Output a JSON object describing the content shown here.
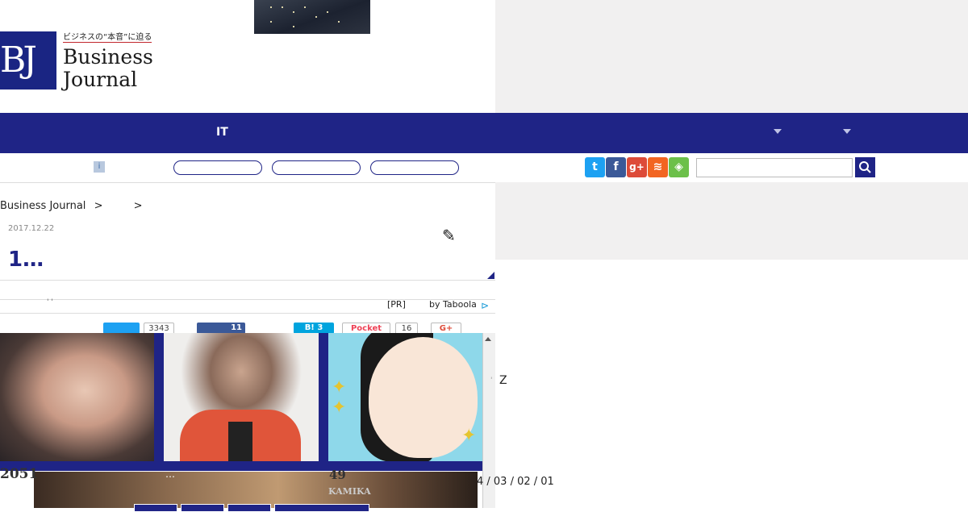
{
  "header": {
    "logo": {
      "mark": "BJ",
      "tagline": "ビジネスの“本音”に迫る",
      "word1": "Business",
      "word2": "Journal"
    }
  },
  "nav": {
    "items": [
      {
        "label": "IT"
      }
    ]
  },
  "social_icons": [
    {
      "name": "twitter",
      "color": "#1da1f2",
      "glyph": "t"
    },
    {
      "name": "facebook",
      "color": "#3b5998",
      "glyph": "f"
    },
    {
      "name": "google-plus",
      "color": "#dd4b39",
      "glyph": "g+"
    },
    {
      "name": "rss",
      "color": "#f26522",
      "glyph": "≋"
    },
    {
      "name": "feedly",
      "color": "#6cc04a",
      "glyph": "◈"
    }
  ],
  "breadcrumb": {
    "home": "Business Journal",
    "sep1": ">",
    "sep2": ">"
  },
  "article": {
    "date": "2017.12.22",
    "title": "1…"
  },
  "taboola": {
    "pr": "[PR]",
    "by": "by Taboola",
    "quote_marks": "' '"
  },
  "share": {
    "twitter_count": "3343",
    "facebook_count": "11",
    "hatena_label": "B! 3",
    "pocket_label": "Pocket",
    "pocket_count": "16",
    "gplus_label": "G+"
  },
  "ranking": {
    "num_left": "2051",
    "num_mid": "49",
    "kamika": "KAMIKA",
    "dots": "…"
  },
  "right": {
    "letter": "Z",
    "pages": "4 / 03 / 02 / 01"
  }
}
